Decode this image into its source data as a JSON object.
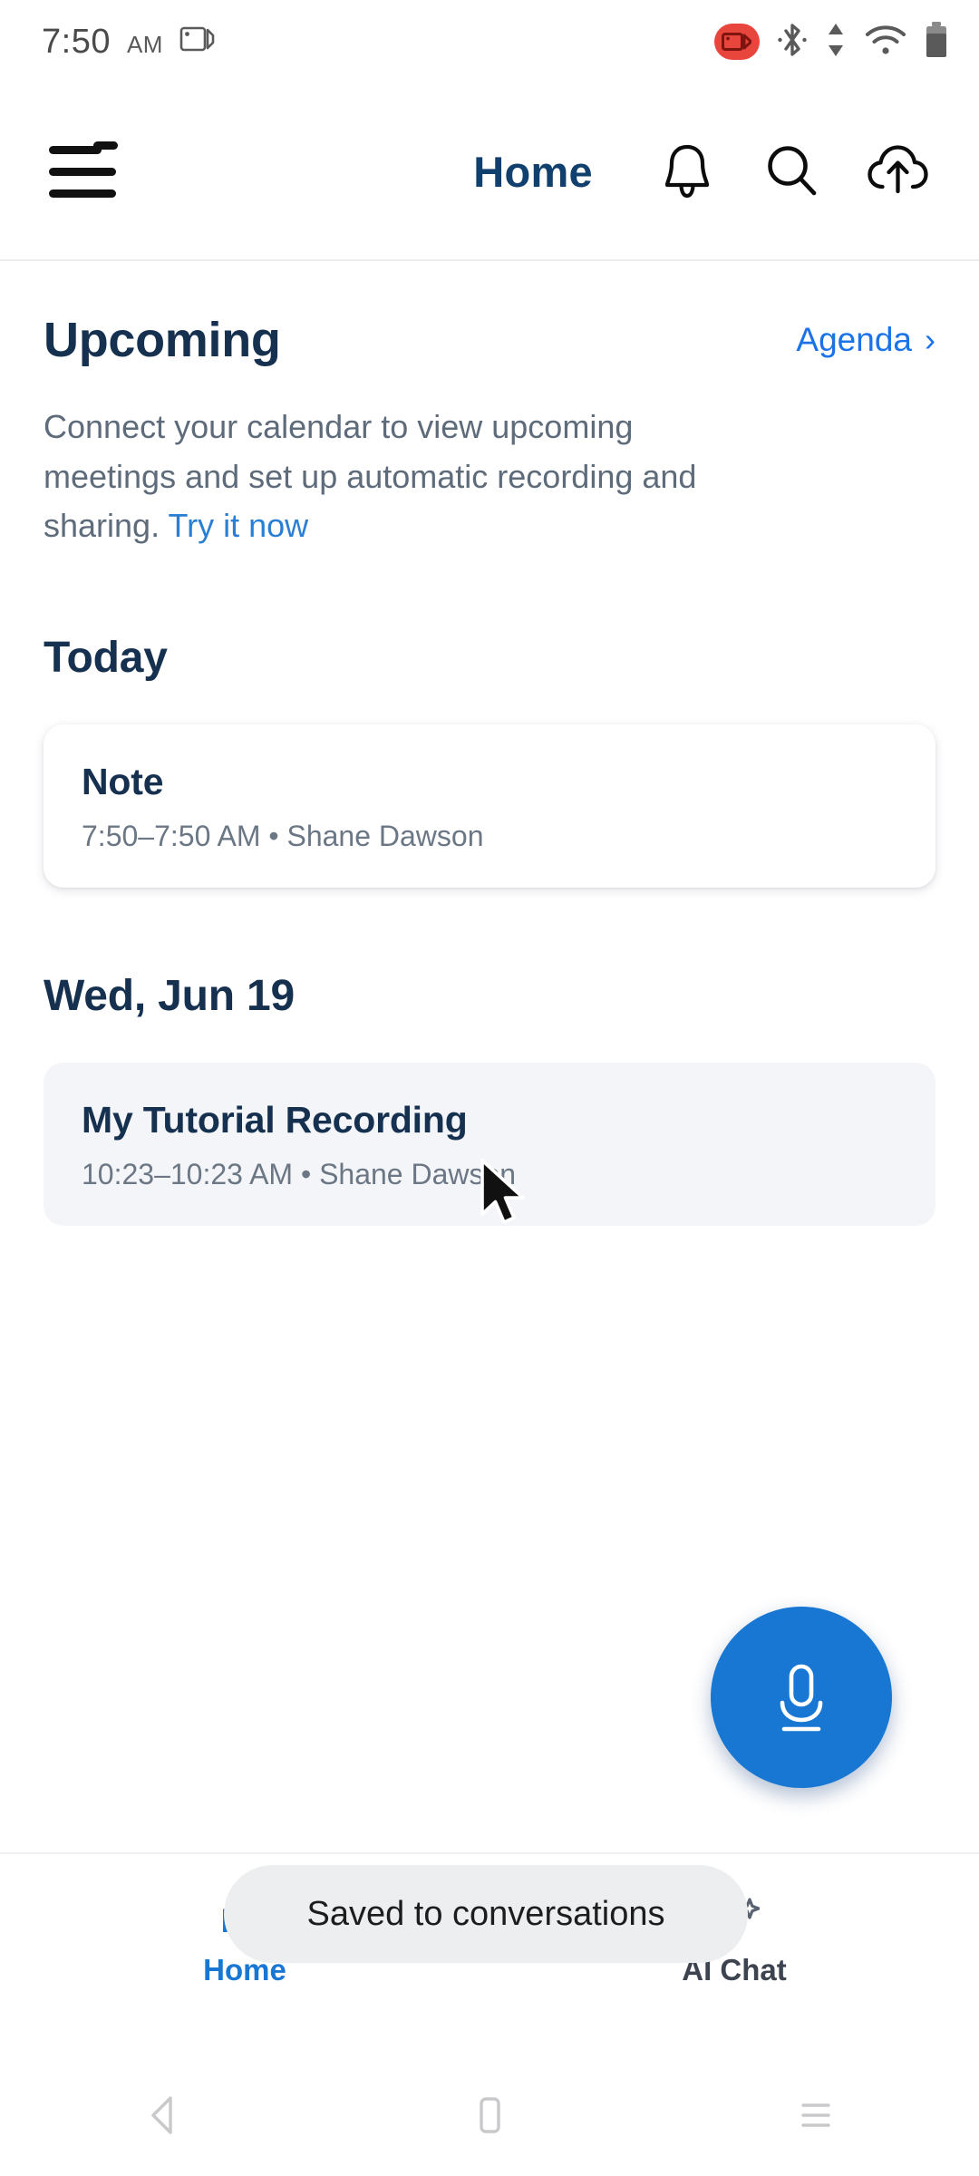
{
  "status_bar": {
    "time": "7:50",
    "ampm": "AM",
    "icons": [
      "screen-cast-icon",
      "screen-record-icon",
      "bluetooth-icon",
      "data-transfer-icon",
      "wifi-icon",
      "battery-icon"
    ]
  },
  "header": {
    "menu_icon": "hamburger-menu-icon",
    "menu_badge": true,
    "title": "Home",
    "actions": [
      "notifications-bell-icon",
      "search-icon",
      "cloud-upload-icon"
    ]
  },
  "upcoming": {
    "heading": "Upcoming",
    "link_label": "Agenda",
    "chevron": "›",
    "description_before": "Connect your calendar to view upcoming meetings and set up automatic recording and sharing. ",
    "description_link": "Try it now"
  },
  "sections": [
    {
      "heading": "Today",
      "card": {
        "title": "Note",
        "subtitle": "7:50–7:50 AM • Shane Dawson",
        "state": "normal"
      }
    },
    {
      "heading": "Wed, Jun 19",
      "card": {
        "title": "My Tutorial Recording",
        "subtitle": "10:23–10:23 AM • Shane Dawson",
        "state": "pressed"
      }
    }
  ],
  "fab": {
    "icon": "microphone-icon",
    "color": "#1877d2"
  },
  "bottom_nav": {
    "items": [
      {
        "label": "Home",
        "icon": "home-icon",
        "active": true
      },
      {
        "label": "AI Chat",
        "icon": "ai-chat-icon",
        "active": false
      }
    ]
  },
  "toast": {
    "message": "Saved to conversations"
  },
  "system_nav": {
    "back": "back-triangle-icon",
    "home": "home-square-icon",
    "recents": "recents-lines-icon"
  },
  "colors": {
    "accent_blue": "#1877d2",
    "link_blue": "#1a73e8",
    "heading_navy": "#16314f",
    "muted_text": "#6b7785",
    "card_pressed": "#f4f5f8",
    "record_red": "#e8453c",
    "badge_red": "#c22026"
  }
}
